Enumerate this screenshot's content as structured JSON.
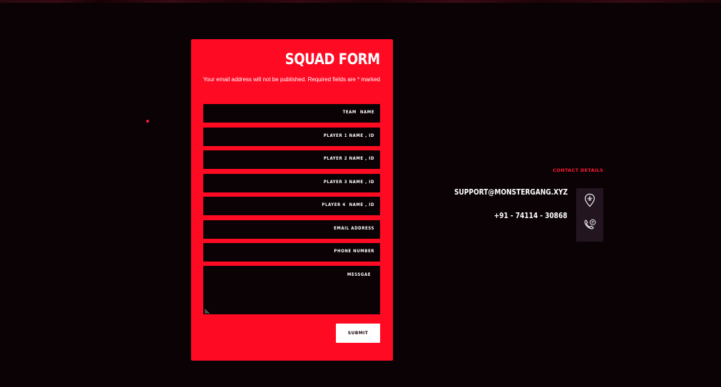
{
  "form": {
    "title": "SQUAD FORM",
    "note": "Your email address will not be published. Required fields are * marked",
    "fields": [
      {
        "label": "TEAM  NAME"
      },
      {
        "label": "PLAYER 1 NAME , ID"
      },
      {
        "label": "PLAYER 2 NAME , ID"
      },
      {
        "label": "PLAYER 3 NAME , ID"
      },
      {
        "label": "PLAYER 4  NAME , ID"
      },
      {
        "label": "EMAIL ADDRESS"
      },
      {
        "label": "PHONE NUMBER"
      }
    ],
    "message_label": "MESSGAE",
    "submit_label": "SUBMIT"
  },
  "contact": {
    "heading": "CONTACT DETAILS",
    "email": "SUPPORT@MONSTERGANG.XYZ",
    "phone": "+91 - 74114 - 30868",
    "icons": [
      "location-pin-icon",
      "phone-icon"
    ]
  },
  "colors": {
    "background": "#0a0204",
    "accent_red": "#ff0a23",
    "field_bg": "#0a0204",
    "icon_panel": "#231520",
    "text": "#ffffff"
  }
}
